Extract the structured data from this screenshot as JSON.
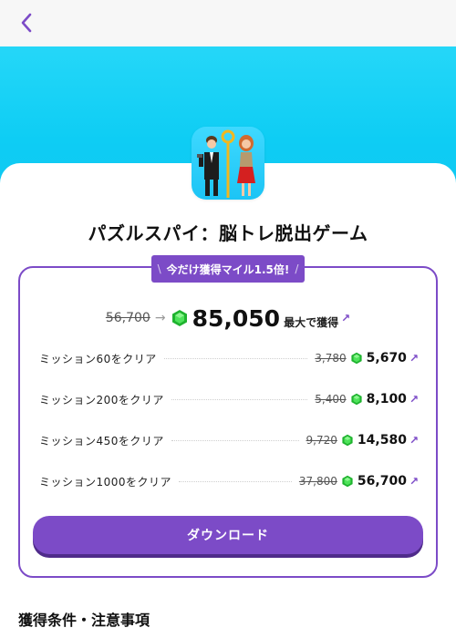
{
  "header": {
    "back_icon": "chevron-left-icon"
  },
  "app": {
    "title": "パズルスパイ：脳トレ脱出ゲーム",
    "icon": "app-icon-spy-puzzle"
  },
  "promo": {
    "badge": "今だけ獲得マイル1.5倍!",
    "old_total": "56,700",
    "new_total": "85,050",
    "suffix": "最大で獲得",
    "gem_icon": "green-gem-icon"
  },
  "missions": [
    {
      "label": "ミッション60をクリア",
      "old": "3,780",
      "new": "5,670"
    },
    {
      "label": "ミッション200をクリア",
      "old": "5,400",
      "new": "8,100"
    },
    {
      "label": "ミッション450をクリア",
      "old": "9,720",
      "new": "14,580"
    },
    {
      "label": "ミッション1000をクリア",
      "old": "37,800",
      "new": "56,700"
    }
  ],
  "download_label": "ダウンロード",
  "conditions_title": "獲得条件・注意事項",
  "colors": {
    "accent": "#7c4bc7",
    "hero": "#1cd0f6",
    "gem": "#29c93a"
  }
}
